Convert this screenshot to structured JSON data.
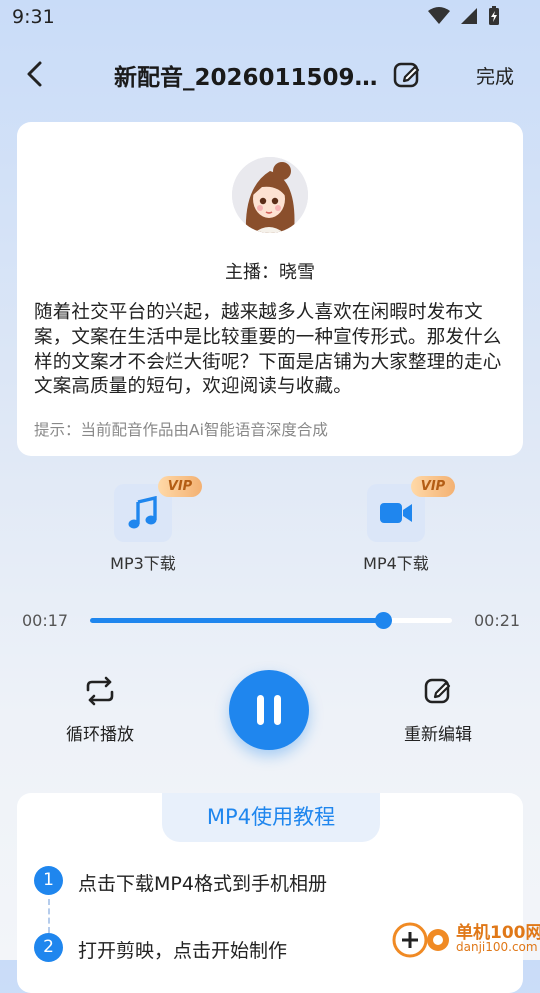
{
  "status": {
    "time": "9:31"
  },
  "header": {
    "title": "新配音_2026011509...",
    "done": "完成"
  },
  "card": {
    "anchor": "主播：晓雪",
    "text": "随着社交平台的兴起，越来越多人喜欢在闲暇时发布文案，文案在生活中是比较重要的一种宣传形式。那发什么样的文案才不会烂大街呢？下面是店铺为大家整理的走心文案高质量的短句，欢迎阅读与收藏。",
    "hint": "提示：当前配音作品由Ai智能语音深度合成"
  },
  "downloads": [
    {
      "label": "MP3下载",
      "badge": "VIP",
      "icon": "music-note-icon"
    },
    {
      "label": "MP4下载",
      "badge": "VIP",
      "icon": "video-camera-icon"
    }
  ],
  "player": {
    "current": "00:17",
    "total": "00:21",
    "progress": 0.81
  },
  "controls": {
    "loop": "循环播放",
    "reedit": "重新编辑"
  },
  "tutorial": {
    "title": "MP4使用教程",
    "steps": [
      {
        "num": "1",
        "text": "点击下载MP4格式到手机相册"
      },
      {
        "num": "2",
        "text": "打开剪映，点击开始制作"
      }
    ]
  },
  "watermark": {
    "name": "单机100网",
    "url": "danji100.com"
  },
  "colors": {
    "accent": "#1f86ee",
    "vip": "#f3b172"
  }
}
